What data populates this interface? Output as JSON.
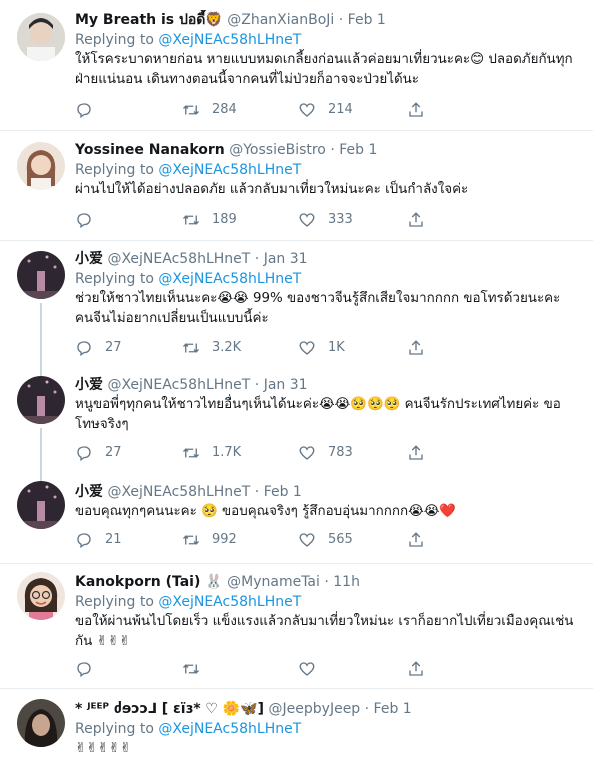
{
  "tweets": [
    {
      "name": "My Breath is ปอดี้🦁",
      "handle": "@ZhanXianBoJi",
      "date": "Feb 1",
      "replying_label": "Replying to",
      "replying_to": "@XejNEAc58hLHneT",
      "text": "ให้โรคระบาดหายก่อน หายแบบหมดเกลี้ยงก่อนแล้วค่อยมาเที่ยวนะคะ😊 ปลอดภัยกันทุกฝ่ายแน่นอน เดินทางตอนนี้จากคนที่ไม่ป่วยก็อาจจะป่วยได้นะ",
      "replies": "",
      "retweets": "284",
      "likes": "214",
      "avatar_color": "#c9c4bf"
    },
    {
      "name": "Yossinee Nanakorn",
      "handle": "@YossieBistro",
      "date": "Feb 1",
      "replying_label": "Replying to",
      "replying_to": "@XejNEAc58hLHneT",
      "text": "ผ่านไปให้ได้อย่างปลอดภัย แล้วกลับมาเที่ยวใหม่นะคะ เป็นกำลังใจค่ะ",
      "replies": "",
      "retweets": "189",
      "likes": "333",
      "avatar_color": "#d8b9a6"
    },
    {
      "name": "小爱",
      "handle": "@XejNEAc58hLHneT",
      "date": "Jan 31",
      "replying_label": "Replying to",
      "replying_to": "@XejNEAc58hLHneT",
      "text": "ช่วยให้ชาวไทยเห็นนะคะ😭😭 99% ของชาวจีนรู้สึกเสียใจมากกกก ขอโทรด้วยนะคะ คนจีนไม่อยากเปลี่ยนเป็นแบบนี้ค่ะ",
      "replies": "27",
      "retweets": "3.2K",
      "likes": "1K",
      "avatar_color": "#3a3038"
    },
    {
      "name": "小爱",
      "handle": "@XejNEAc58hLHneT",
      "date": "Jan 31",
      "text": "หนูขอพี่ๆทุกคนให้ชาวไทยอื่นๆเห็นได้นะค่ะ😭😭🥺🥺🥺 คนจีนรักประเทศไทยค่ะ ขอโทษจริงๆ",
      "replies": "27",
      "retweets": "1.7K",
      "likes": "783",
      "avatar_color": "#3a3038"
    },
    {
      "name": "小爱",
      "handle": "@XejNEAc58hLHneT",
      "date": "Feb 1",
      "text": "ขอบคุณทุกๆคนนะคะ 🥺 ขอบคุณจริงๆ รู้สึกอบอุ่นมากกกก😭😭❤️",
      "replies": "21",
      "retweets": "992",
      "likes": "565",
      "avatar_color": "#3a3038"
    },
    {
      "name": "Kanokporn (Tai) 🐰",
      "handle": "@MynameTai",
      "date": "11h",
      "replying_label": "Replying to",
      "replying_to": "@XejNEAc58hLHneT",
      "text": "ขอให้ผ่านพ้นไปโดยเร็ว แข็งแรงแล้วกลับมาเที่ยวใหม่นะ เราก็อยากไปเที่ยวเมืองคุณเช่นกัน ✌✌✌",
      "replies": "",
      "retweets": "",
      "likes": "",
      "avatar_color": "#e3c7b3"
    },
    {
      "name": "* ᴶᴱᴱᴾ ძɘɔɔ⅃ [ ɛïɜ* ♡ 🌼🦋]",
      "handle": "@JeepbyJeep",
      "date": "Feb 1",
      "replying_label": "Replying to",
      "replying_to": "@XejNEAc58hLHneT",
      "text": "✌✌✌✌✌",
      "avatar_color": "#5a5550"
    }
  ],
  "dot": "·"
}
